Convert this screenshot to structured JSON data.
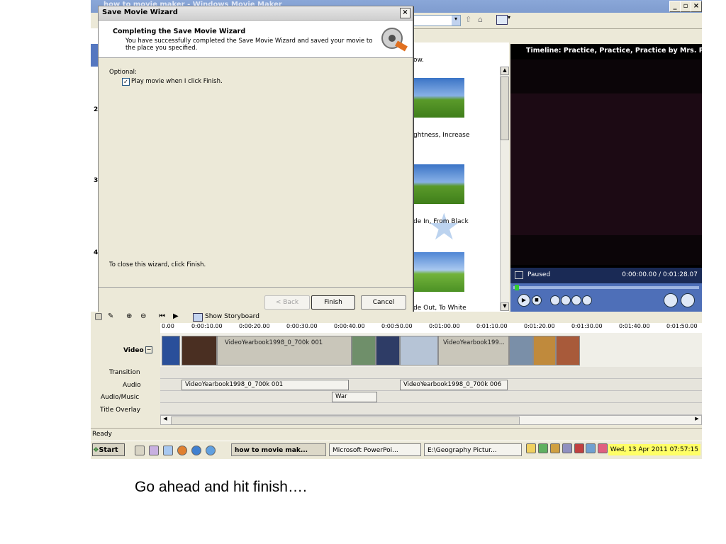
{
  "window": {
    "title": "how to movie maker - Windows Movie Maker"
  },
  "dialog": {
    "title": "Save Movie Wizard",
    "heading": "Completing the Save Movie Wizard",
    "description": "You have successfully completed the Save Movie Wizard and saved your movie to the place you specified.",
    "optional_label": "Optional:",
    "play_checkbox_label": "Play movie when I click Finish.",
    "play_checked": true,
    "close_hint": "To close this wizard, click Finish.",
    "back_label": "< Back",
    "finish_label": "Finish",
    "cancel_label": "Cancel"
  },
  "content": {
    "items": [
      {
        "label": "ow."
      },
      {
        "label": "ghtness, Increase"
      },
      {
        "label": "de In, From Black"
      },
      {
        "label": "de Out, To White"
      }
    ]
  },
  "left_numbers": [
    "2",
    "3",
    "4"
  ],
  "preview": {
    "title": "Timeline: Practice, Practice, Practice by Mrs. P",
    "status": "Paused",
    "time": "0:00:00.00 / 0:01:28.07"
  },
  "timeline": {
    "show_storyboard_label": "Show Storyboard",
    "ruler": [
      "0.00",
      "0:00:10.00",
      "0:00:20.00",
      "0:00:30.00",
      "0:00:40.00",
      "0:00:50.00",
      "0:01:00.00",
      "0:01:10.00",
      "0:01:20.00",
      "0:01:30.00",
      "0:01:40.00",
      "0:01:50.00"
    ],
    "tracks": {
      "video": "Video",
      "transition": "Transition",
      "audio": "Audio",
      "audio_music": "Audio/Music",
      "title_overlay": "Title Overlay"
    },
    "video_clips": [
      "VideoYearbook1998_0_700k 001",
      "VideoYearbook199..."
    ],
    "audio_clips": [
      "VideoYearbook1998_0_700k 001",
      "VideoYearbook1998_0_700k 006"
    ],
    "music_clip": "War"
  },
  "status": {
    "text": "Ready"
  },
  "taskbar": {
    "start_label": "Start",
    "tasks": [
      "how to movie mak...",
      "Microsoft PowerPoi...",
      "E:\\Geography Pictur..."
    ],
    "clock": "Wed, 13 Apr 2011  07:57:15"
  },
  "caption": "Go ahead and hit finish…."
}
